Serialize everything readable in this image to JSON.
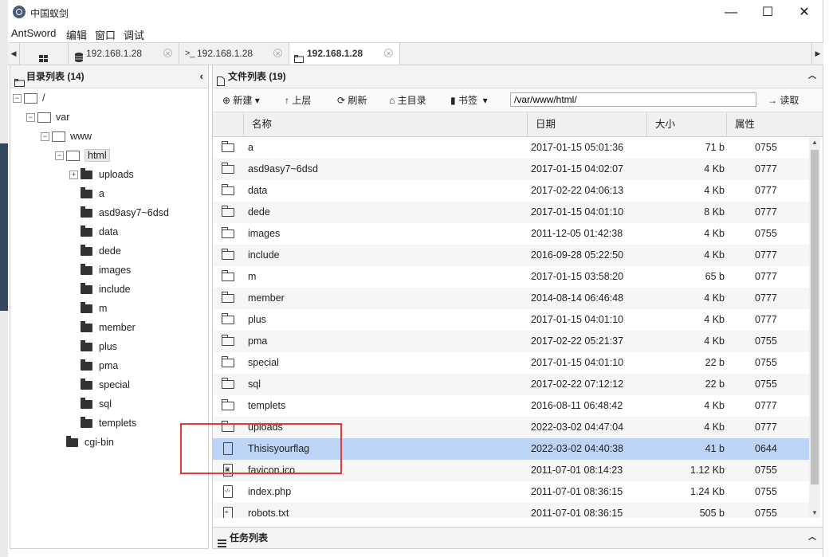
{
  "window": {
    "title": "中国蚁剑",
    "controls": {
      "minimize": "—",
      "maximize": "☐",
      "close": "✕"
    }
  },
  "menu": [
    "AntSword",
    "编辑",
    "窗口",
    "调试"
  ],
  "tabs": [
    {
      "label": "",
      "icon": "grid-icon"
    },
    {
      "label": "192.168.1.28",
      "icon": "database-icon"
    },
    {
      "label": "192.168.1.28",
      "icon": "terminal-icon",
      "prefix": ">_"
    },
    {
      "label": "192.168.1.28",
      "icon": "folder-icon",
      "active": true
    }
  ],
  "left_panel": {
    "title": "目录列表 (14)",
    "tree": [
      "/",
      "var",
      "www",
      "html",
      "uploads",
      "a",
      "asd9asy7~6dsd",
      "data",
      "dede",
      "images",
      "include",
      "m",
      "member",
      "plus",
      "pma",
      "special",
      "sql",
      "templets",
      "cgi-bin"
    ]
  },
  "right_panel": {
    "title": "文件列表 (19)",
    "toolbar": {
      "new": "新建",
      "up": "上层",
      "refresh": "刷新",
      "home": "主目录",
      "bookmark": "书签",
      "path": "/var/www/html/",
      "read": "读取"
    },
    "columns": [
      "名称",
      "日期",
      "大小",
      "属性"
    ],
    "files": [
      {
        "name": "a",
        "date": "2017-01-15 05:01:36",
        "size": "71 b",
        "perm": "0755",
        "type": "folder"
      },
      {
        "name": "asd9asy7~6dsd",
        "date": "2017-01-15 04:02:07",
        "size": "4 Kb",
        "perm": "0777",
        "type": "folder"
      },
      {
        "name": "data",
        "date": "2017-02-22 04:06:13",
        "size": "4 Kb",
        "perm": "0777",
        "type": "folder"
      },
      {
        "name": "dede",
        "date": "2017-01-15 04:01:10",
        "size": "8 Kb",
        "perm": "0777",
        "type": "folder"
      },
      {
        "name": "images",
        "date": "2011-12-05 01:42:38",
        "size": "4 Kb",
        "perm": "0755",
        "type": "folder"
      },
      {
        "name": "include",
        "date": "2016-09-28 05:22:50",
        "size": "4 Kb",
        "perm": "0777",
        "type": "folder"
      },
      {
        "name": "m",
        "date": "2017-01-15 03:58:20",
        "size": "65 b",
        "perm": "0777",
        "type": "folder"
      },
      {
        "name": "member",
        "date": "2014-08-14 06:46:48",
        "size": "4 Kb",
        "perm": "0777",
        "type": "folder"
      },
      {
        "name": "plus",
        "date": "2017-01-15 04:01:10",
        "size": "4 Kb",
        "perm": "0777",
        "type": "folder"
      },
      {
        "name": "pma",
        "date": "2017-02-22 05:21:37",
        "size": "4 Kb",
        "perm": "0755",
        "type": "folder"
      },
      {
        "name": "special",
        "date": "2017-01-15 04:01:10",
        "size": "22 b",
        "perm": "0755",
        "type": "folder"
      },
      {
        "name": "sql",
        "date": "2017-02-22 07:12:12",
        "size": "22 b",
        "perm": "0755",
        "type": "folder"
      },
      {
        "name": "templets",
        "date": "2016-08-11 06:48:42",
        "size": "4 Kb",
        "perm": "0777",
        "type": "folder"
      },
      {
        "name": "uploads",
        "date": "2022-03-02 04:47:04",
        "size": "4 Kb",
        "perm": "0777",
        "type": "folder"
      },
      {
        "name": "Thisisyourflag",
        "date": "2022-03-02 04:40:38",
        "size": "41 b",
        "perm": "0644",
        "type": "file",
        "selected": true
      },
      {
        "name": "favicon.ico",
        "date": "2011-07-01 08:14:23",
        "size": "1.12 Kb",
        "perm": "0755",
        "type": "image"
      },
      {
        "name": "index.php",
        "date": "2011-07-01 08:36:15",
        "size": "1.24 Kb",
        "perm": "0755",
        "type": "code"
      },
      {
        "name": "robots.txt",
        "date": "2011-07-01 08:36:15",
        "size": "505 b",
        "perm": "0755",
        "type": "text"
      }
    ]
  },
  "task_panel": {
    "title": "任务列表"
  },
  "colors": {
    "selected_row": "#bcd4f5",
    "highlight_box": "#e53935"
  }
}
